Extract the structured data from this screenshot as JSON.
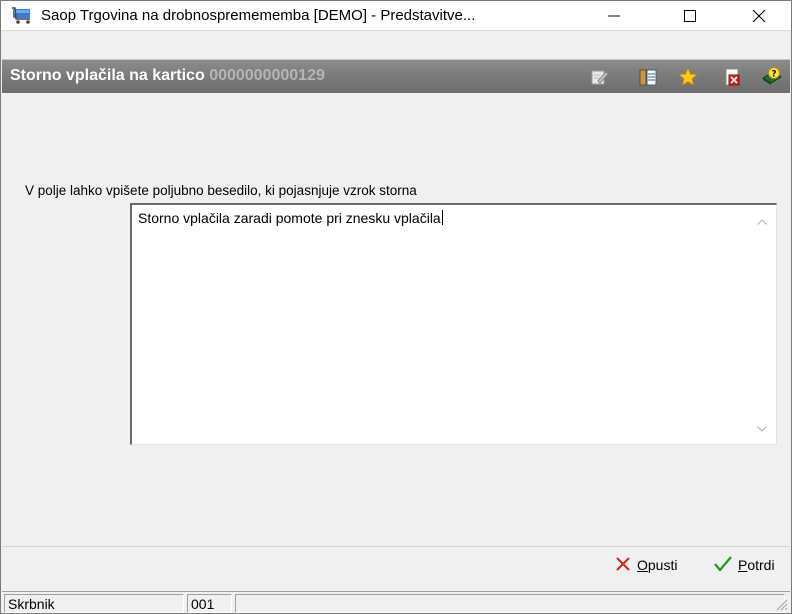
{
  "window": {
    "title": "Saop Trgovina na drobnospremememba [DEMO] - Predstavitve...",
    "minimize_icon": "minimize-icon",
    "maximize_icon": "maximize-icon",
    "close_icon": "close-icon"
  },
  "header": {
    "title": "Storno vplačila na kartico",
    "card_number": "0000000000129",
    "icons": [
      "edit-note-icon",
      "columns-icon",
      "star-icon",
      "delete-doc-icon",
      "help-book-icon"
    ],
    "colors": {
      "band": "#7a7a7a",
      "title": "#ffffff",
      "code": "#b5b5b5"
    }
  },
  "form": {
    "instruction": "V polje lahko vpišete poljubno besedilo, ki pojasnjuje vzrok storna",
    "reason_value": "Storno vplačila zaradi pomote pri znesku vplačila"
  },
  "actions": {
    "cancel_label_u": "O",
    "cancel_label_rest": "pusti",
    "confirm_label_u": "P",
    "confirm_label_rest": "otrdi",
    "colors": {
      "cancel": "#d42424",
      "confirm": "#1e9a1e"
    }
  },
  "statusbar": {
    "user": "Skrbnik",
    "code": "001",
    "empty": ""
  }
}
